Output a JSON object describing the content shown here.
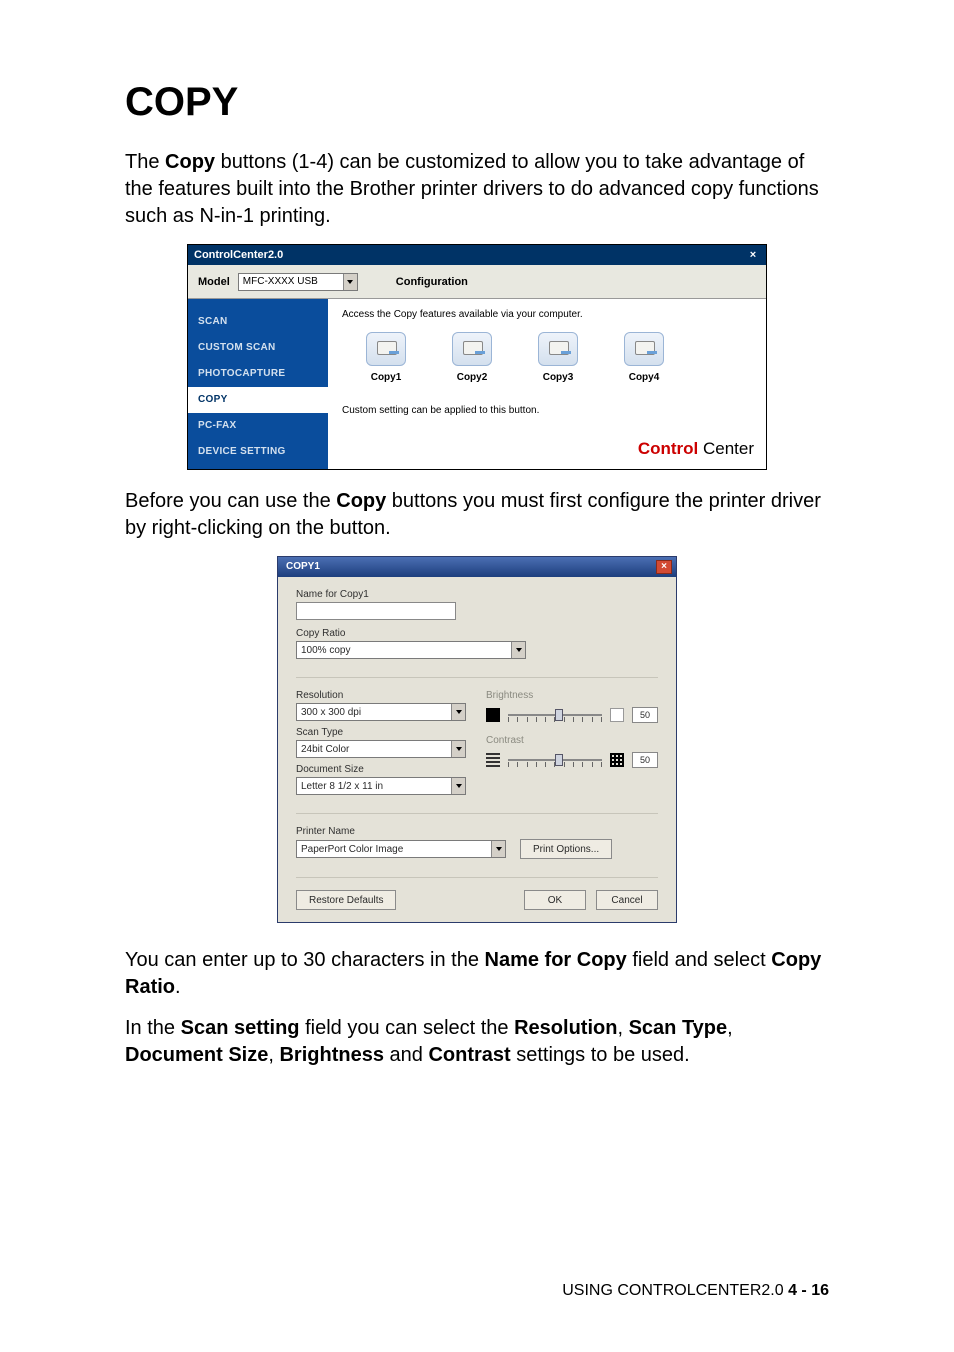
{
  "heading": "COPY",
  "para1_pre": "The ",
  "para1_bold": "Copy",
  "para1_post": " buttons (1-4) can be customized to allow you to take advantage of the features built into the Brother printer drivers to do advanced copy functions such as N-in-1 printing.",
  "app": {
    "title": "ControlCenter2.0",
    "close": "×",
    "model_label": "Model",
    "model_value": "MFC-XXXX USB",
    "config": "Configuration",
    "desc": "Access the Copy features available via your computer.",
    "hint": "Custom setting can be applied to this button.",
    "sidebar": [
      "SCAN",
      "CUSTOM SCAN",
      "PHOTOCAPTURE",
      "COPY",
      "PC-FAX",
      "DEVICE SETTING"
    ],
    "icons": [
      "Copy1",
      "Copy2",
      "Copy3",
      "Copy4"
    ],
    "brand1": "Control",
    "brand2": " Center"
  },
  "para2_pre": "Before you can use the ",
  "para2_bold": "Copy",
  "para2_post": " buttons you must first configure the printer driver by right-clicking on the button.",
  "dlg": {
    "title": "COPY1",
    "close": "×",
    "name_label": "Name for Copy1",
    "ratio_label": "Copy Ratio",
    "ratio_value": "100% copy",
    "res_label": "Resolution",
    "res_value": "300 x 300 dpi",
    "scantype_label": "Scan Type",
    "scantype_value": "24bit Color",
    "docsize_label": "Document Size",
    "docsize_value": "Letter 8 1/2 x 11 in",
    "brightness_label": "Brightness",
    "brightness_value": "50",
    "contrast_label": "Contrast",
    "contrast_value": "50",
    "printer_label": "Printer Name",
    "printer_value": "PaperPort Color Image",
    "print_options": "Print Options...",
    "restore": "Restore Defaults",
    "ok": "OK",
    "cancel": "Cancel"
  },
  "para3": {
    "t1": "You can enter up to 30 characters in the ",
    "b1": "Name for Copy",
    "t2": " field and select ",
    "b2": "Copy Ratio",
    "t3": "."
  },
  "para4": {
    "t1": "In the ",
    "b1": "Scan setting",
    "t2": " field you can select the ",
    "b2": "Resolution",
    "t3": ", ",
    "b3": "Scan Type",
    "t4": ", ",
    "b4": "Document Size",
    "t5": ", ",
    "b5": "Brightness",
    "t6": " and ",
    "b6": "Contrast",
    "t7": " settings to be used."
  },
  "footer": {
    "text": "USING CONTROLCENTER2.0",
    "sep": "   ",
    "page": "4 - 16"
  }
}
